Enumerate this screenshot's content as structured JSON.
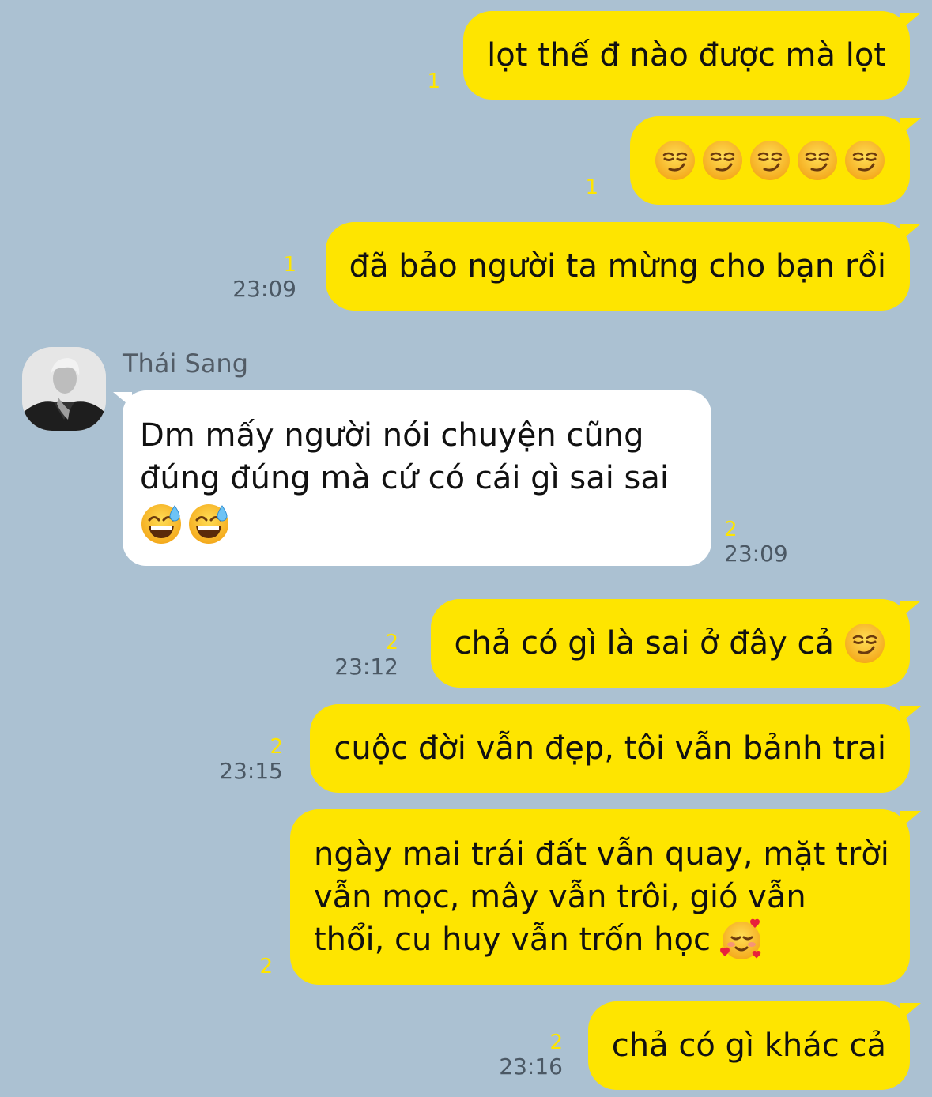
{
  "colors": {
    "background": "#abc1d2",
    "outgoing_bubble": "#fee500",
    "incoming_bubble": "#ffffff",
    "unread_count": "#fee500",
    "timestamp": "#4b5864"
  },
  "messages": [
    {
      "direction": "out",
      "text": "lọt thế đ nào được mà lọt",
      "unread": "1",
      "time": ""
    },
    {
      "direction": "out",
      "emojis": [
        "smirking-face",
        "smirking-face",
        "smirking-face",
        "smirking-face",
        "smirking-face"
      ],
      "unread": "1",
      "time": ""
    },
    {
      "direction": "out",
      "text": "đã bảo người ta mừng cho bạn rồi",
      "unread": "1",
      "time": "23:09"
    },
    {
      "direction": "in",
      "sender": "Thái Sang",
      "avatar": "avatar-photo",
      "lines": [
        "Dm mấy người nói chuyện cũng",
        "đúng đúng mà cứ có cái gì sai sai"
      ],
      "emojis": [
        "grinning-face-with-sweat",
        "grinning-face-with-sweat"
      ],
      "unread": "2",
      "time": "23:09"
    },
    {
      "direction": "out",
      "text": "chả có gì là sai ở đây cả",
      "emojis": [
        "smirking-face"
      ],
      "unread": "2",
      "time": "23:12"
    },
    {
      "direction": "out",
      "text": "cuộc đời vẫn đẹp, tôi vẫn bảnh trai",
      "unread": "2",
      "time": "23:15"
    },
    {
      "direction": "out",
      "lines": [
        "ngày mai trái đất vẫn quay, mặt trời",
        "vẫn mọc, mây vẫn trôi, gió vẫn",
        "thổi, cu huy vẫn trốn học"
      ],
      "emojis": [
        "smiling-face-with-hearts"
      ],
      "unread": "2",
      "time": ""
    },
    {
      "direction": "out",
      "text": "chả có gì khác cả",
      "unread": "2",
      "time": "23:16"
    }
  ]
}
